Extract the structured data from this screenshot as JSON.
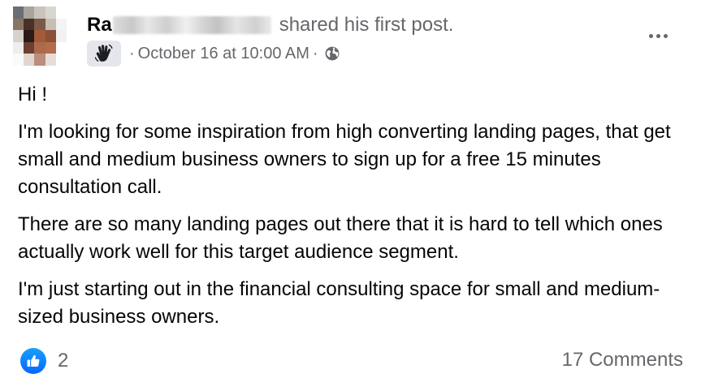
{
  "post": {
    "author": {
      "name_visible": "Ra",
      "action_text": "shared his first post."
    },
    "meta": {
      "badge_icon": "wave-hand-icon",
      "separator": "·",
      "timestamp": "October 16 at 10:00 AM",
      "privacy_icon": "globe-icon"
    },
    "body": {
      "greeting": "Hi !",
      "paragraphs": [
        "I'm looking for some inspiration from high converting landing pages, that get small and medium business owners to sign up for a free 15 minutes consultation call.",
        "There are so many landing pages out there that it is hard to tell which ones actually work well for this target audience segment.",
        "I'm just starting out in the financial consulting space for small and medium-sized business owners."
      ]
    },
    "footer": {
      "reaction_icon": "like-icon",
      "reaction_count": "2",
      "comments_label": "17 Comments"
    },
    "colors": {
      "primary_text": "#050505",
      "secondary_text": "#65676b",
      "like_blue": "#0866ff",
      "badge_bg": "#e4e6eb"
    }
  }
}
